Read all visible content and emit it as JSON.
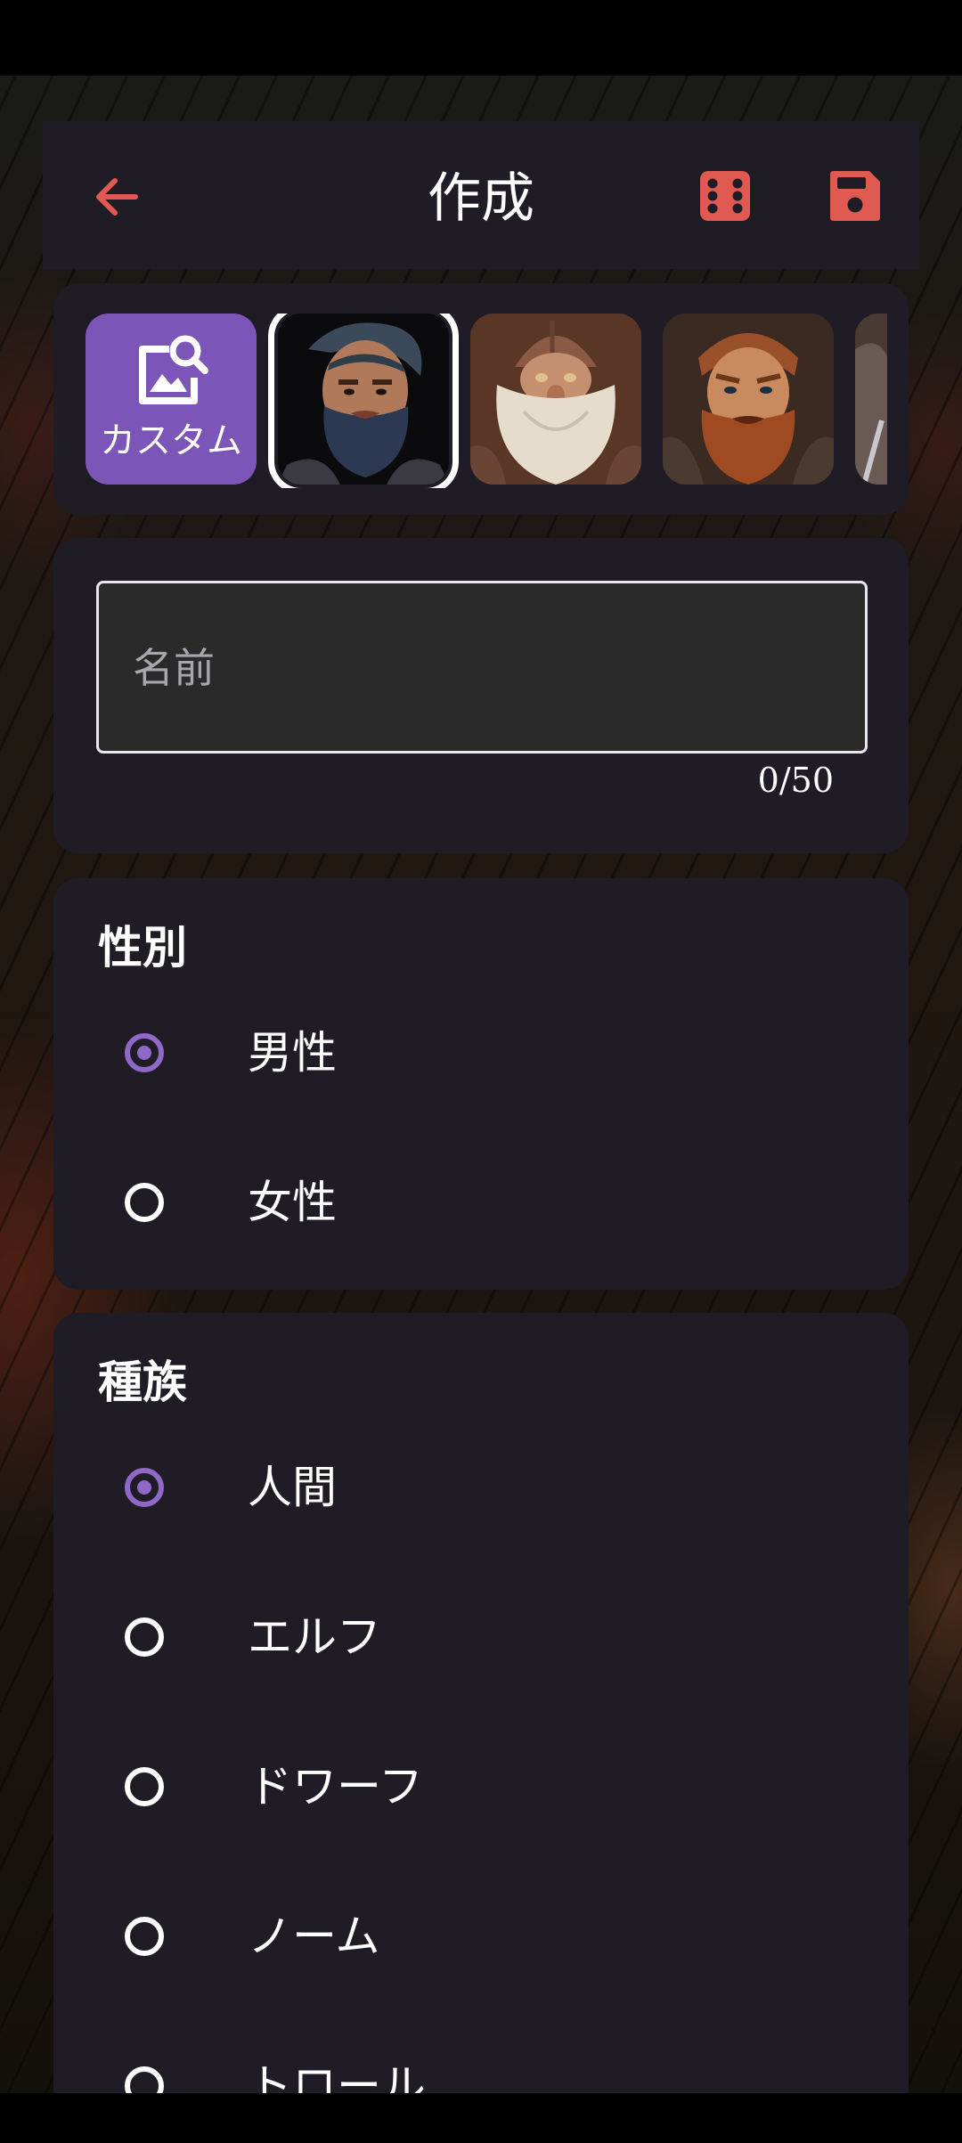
{
  "app_bar": {
    "title": "作成",
    "icons": {
      "back": "arrow-left-icon",
      "randomize": "dice-icon",
      "save": "floppy-disk-icon"
    },
    "accent_color": "#e05a52"
  },
  "portraits": {
    "custom_label": "カスタム",
    "custom_icon": "image-search-icon",
    "custom_color": "#7b55b8",
    "items": [
      {
        "id": "portrait-1",
        "selected": true
      },
      {
        "id": "portrait-2",
        "selected": false
      },
      {
        "id": "portrait-3",
        "selected": false
      },
      {
        "id": "portrait-4",
        "selected": false
      }
    ]
  },
  "name": {
    "placeholder": "名前",
    "value": "",
    "counter": "0/50"
  },
  "gender": {
    "title": "性別",
    "options": [
      {
        "label": "男性",
        "checked": true
      },
      {
        "label": "女性",
        "checked": false
      }
    ]
  },
  "race": {
    "title": "種族",
    "options": [
      {
        "label": "人間",
        "checked": true
      },
      {
        "label": "エルフ",
        "checked": false
      },
      {
        "label": "ドワーフ",
        "checked": false
      },
      {
        "label": "ノーム",
        "checked": false
      },
      {
        "label": "トロール",
        "checked": false
      }
    ]
  },
  "radio_color": "#9068c8"
}
